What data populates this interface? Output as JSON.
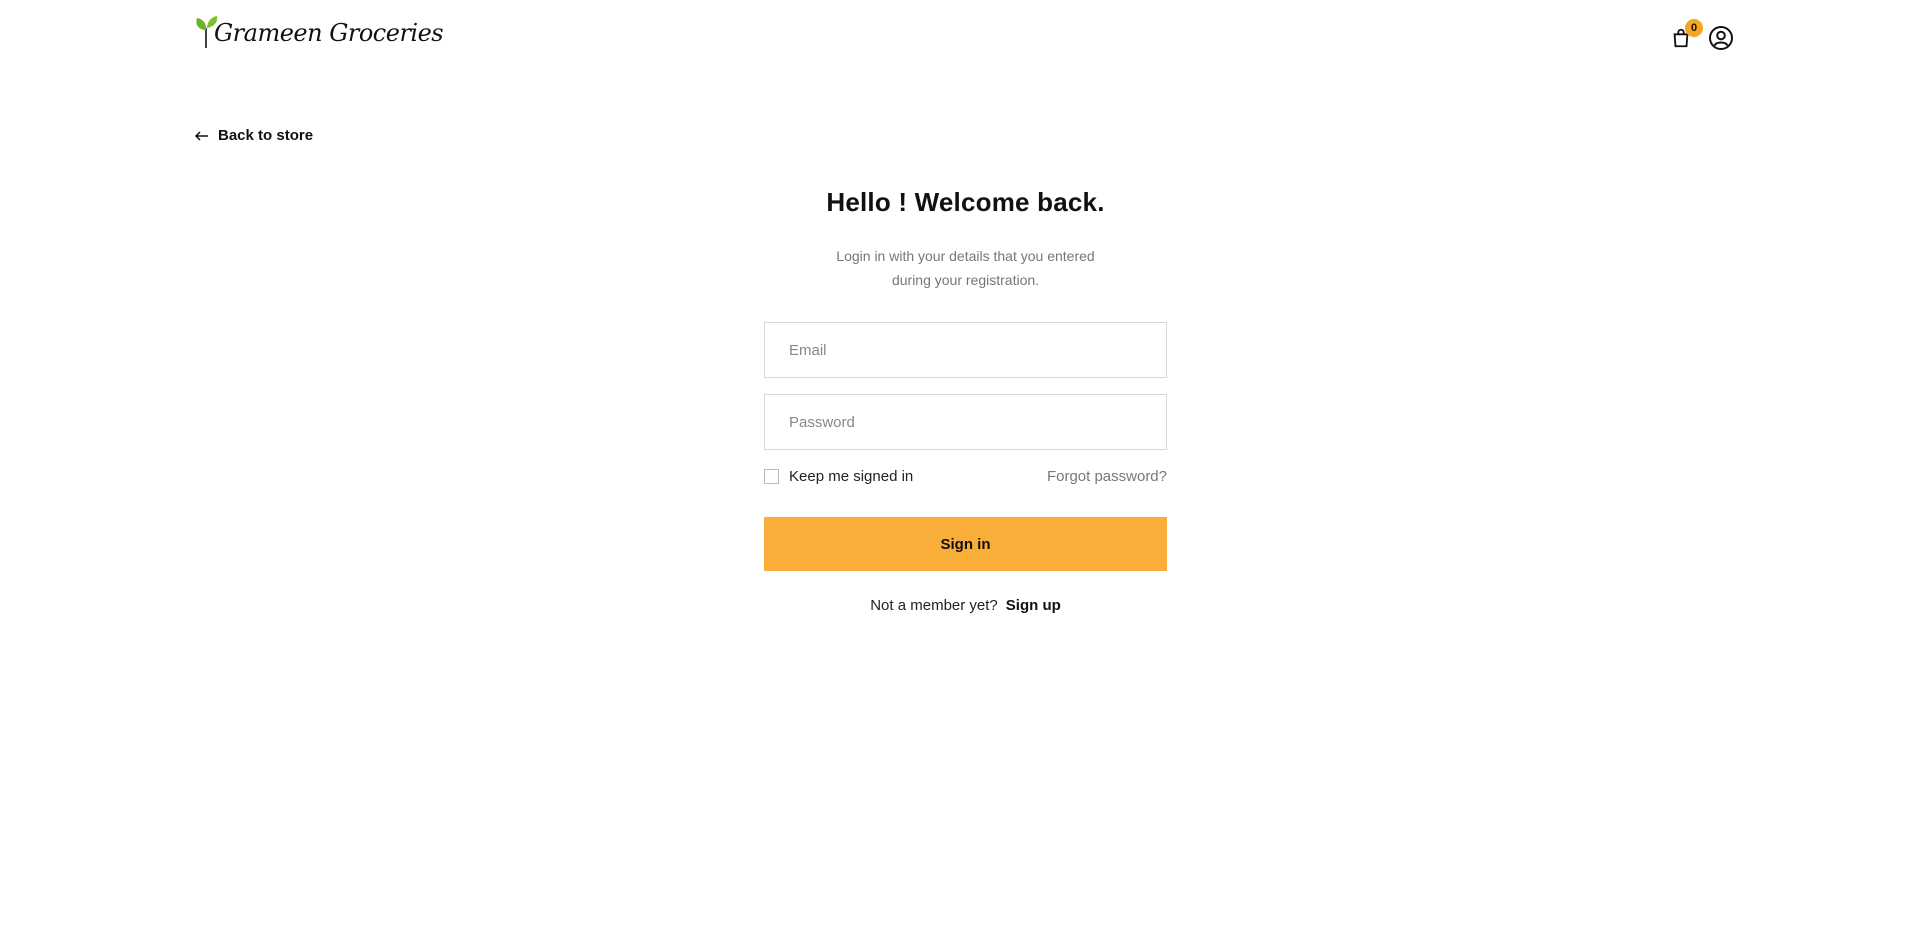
{
  "header": {
    "logo_text": "Grameen Groceries",
    "cart_count": "0",
    "cart_icon": "shopping-bag-icon",
    "account_icon": "user-circle-icon"
  },
  "nav": {
    "back_label": "Back to store",
    "back_icon": "arrow-left-icon"
  },
  "login": {
    "title": "Hello ! Welcome back.",
    "subtitle": "Login in with your details that you entered during your registration.",
    "email_placeholder": "Email",
    "email_value": "",
    "password_placeholder": "Password",
    "password_value": "",
    "remember_label": "Keep me signed in",
    "remember_checked": false,
    "forgot_label": "Forgot password?",
    "submit_label": "Sign in",
    "signup_prompt": "Not a member yet?",
    "signup_link": "Sign up"
  },
  "colors": {
    "accent": "#f9ae3a",
    "badge": "#f5a623",
    "leaf": "#6bb324"
  }
}
